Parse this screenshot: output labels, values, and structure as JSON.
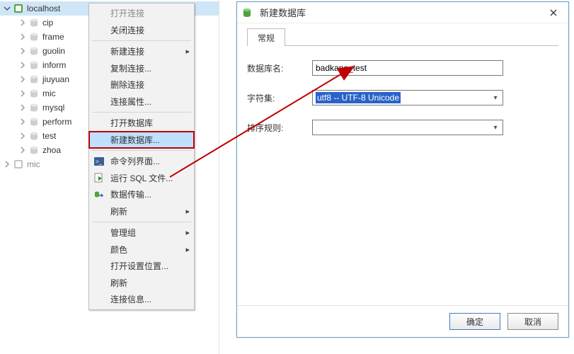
{
  "tree": {
    "root": {
      "label": "localhost",
      "icon": "connection-icon"
    },
    "items": [
      {
        "label": "cip"
      },
      {
        "label": "frame"
      },
      {
        "label": "guolin"
      },
      {
        "label": "inform"
      },
      {
        "label": "jiuyuan"
      },
      {
        "label": "mic"
      },
      {
        "label": "mysql"
      },
      {
        "label": "perform"
      },
      {
        "label": "test"
      },
      {
        "label": "zhoa"
      }
    ],
    "extra": {
      "label": "mic"
    }
  },
  "menu": {
    "items": [
      {
        "label": "打开连接",
        "disabled": true
      },
      {
        "label": "关闭连接"
      },
      {
        "sep": true
      },
      {
        "label": "新建连接",
        "sub": true
      },
      {
        "label": "复制连接..."
      },
      {
        "label": "删除连接"
      },
      {
        "label": "连接属性..."
      },
      {
        "sep": true
      },
      {
        "label": "打开数据库"
      },
      {
        "label": "新建数据库...",
        "highlight": true
      },
      {
        "sep": true
      },
      {
        "label": "命令列界面...",
        "icon": "cmd-icon"
      },
      {
        "label": "运行 SQL 文件...",
        "icon": "sql-icon"
      },
      {
        "label": "数据传输...",
        "icon": "transfer-icon"
      },
      {
        "label": "刷新",
        "sub": true
      },
      {
        "sep": true
      },
      {
        "label": "管理组",
        "sub": true
      },
      {
        "label": "颜色",
        "sub": true
      },
      {
        "label": "打开设置位置..."
      },
      {
        "label": "刷新"
      },
      {
        "label": "连接信息..."
      }
    ]
  },
  "dialog": {
    "title": "新建数据库",
    "tab_general": "常规",
    "labels": {
      "dbname": "数据库名:",
      "charset": "字符集:",
      "collation": "排序规则:"
    },
    "values": {
      "dbname": "badkano_test",
      "charset": "utf8 -- UTF-8 Unicode",
      "collation": ""
    },
    "buttons": {
      "ok": "确定",
      "cancel": "取消"
    }
  }
}
